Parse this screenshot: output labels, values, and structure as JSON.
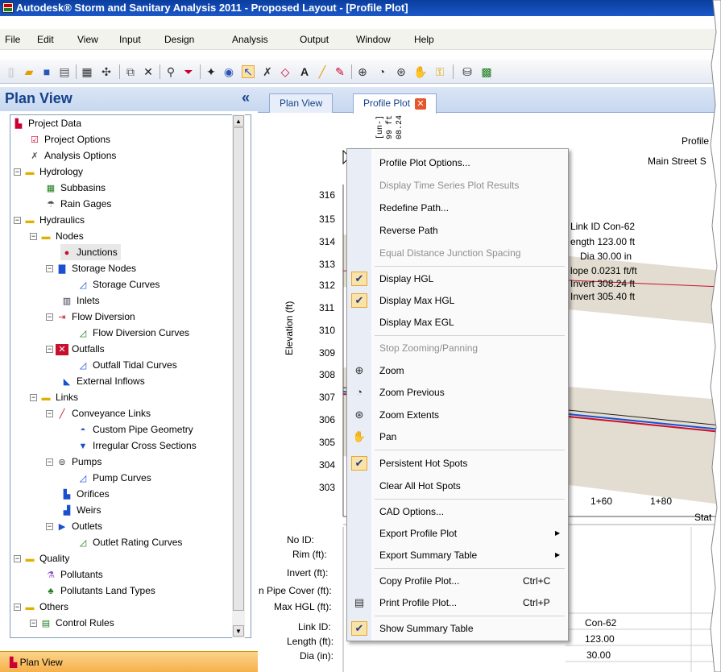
{
  "window": {
    "title": "Autodesk® Storm and Sanitary Analysis 2011 - Proposed Layout - [Profile Plot]"
  },
  "menu": [
    "File",
    "Edit",
    "View",
    "Input",
    "Design",
    "Analysis",
    "Output",
    "Window",
    "Help"
  ],
  "toolbar_icons": [
    "new-icon",
    "open-icon",
    "save-icon",
    "print-icon",
    "calculator-icon",
    "crosshair-icon",
    "copy-icon",
    "delete-icon",
    "find-icon",
    "filter-icon",
    "run-icon",
    "help-icon",
    "select-icon",
    "tools-icon",
    "polygon-icon",
    "text-icon",
    "measure-icon",
    "edit-icon",
    "zoom-in-icon",
    "zoom-previous-icon",
    "zoom-extents-icon",
    "pan-icon",
    "lock-icon",
    "network-icon",
    "spreadsheet-icon"
  ],
  "left_panel": {
    "title": "Plan View",
    "collapse": "«",
    "tree": [
      {
        "label": "Project Data",
        "icon": "project-data-icon"
      },
      {
        "label": "Project Options",
        "icon": "checklist-icon"
      },
      {
        "label": "Analysis Options",
        "icon": "tools-icon"
      },
      {
        "label": "Hydrology",
        "icon": "folder-icon"
      },
      {
        "label": "Subbasins",
        "icon": "subbasin-icon"
      },
      {
        "label": "Rain Gages",
        "icon": "rain-gage-icon"
      },
      {
        "label": "Hydraulics",
        "icon": "folder-icon"
      },
      {
        "label": "Nodes",
        "icon": "folder-icon"
      },
      {
        "label": "Junctions",
        "icon": "junction-icon"
      },
      {
        "label": "Storage Nodes",
        "icon": "storage-icon"
      },
      {
        "label": "Storage Curves",
        "icon": "curve-icon"
      },
      {
        "label": "Inlets",
        "icon": "inlet-icon"
      },
      {
        "label": "Flow Diversion",
        "icon": "flow-diversion-icon"
      },
      {
        "label": "Flow Diversion Curves",
        "icon": "curve-icon"
      },
      {
        "label": "Outfalls",
        "icon": "outfall-icon"
      },
      {
        "label": "Outfall Tidal Curves",
        "icon": "curve-icon"
      },
      {
        "label": "External Inflows",
        "icon": "inflow-icon"
      },
      {
        "label": "Links",
        "icon": "folder-icon"
      },
      {
        "label": "Conveyance Links",
        "icon": "conveyance-icon"
      },
      {
        "label": "Custom Pipe Geometry",
        "icon": "pipe-geometry-icon"
      },
      {
        "label": "Irregular Cross Sections",
        "icon": "cross-section-icon"
      },
      {
        "label": "Pumps",
        "icon": "pump-icon"
      },
      {
        "label": "Pump Curves",
        "icon": "curve-icon"
      },
      {
        "label": "Orifices",
        "icon": "orifice-icon"
      },
      {
        "label": "Weirs",
        "icon": "weir-icon"
      },
      {
        "label": "Outlets",
        "icon": "outlet-icon"
      },
      {
        "label": "Outlet Rating Curves",
        "icon": "curve-icon"
      },
      {
        "label": "Quality",
        "icon": "folder-icon"
      },
      {
        "label": "Pollutants",
        "icon": "flask-icon"
      },
      {
        "label": "Pollutants Land Types",
        "icon": "tree-icon"
      },
      {
        "label": "Others",
        "icon": "folder-icon"
      },
      {
        "label": "Control Rules",
        "icon": "control-rules-icon"
      }
    ],
    "bottom_tab": "Plan View"
  },
  "tabs": [
    "Plan View",
    "Profile Plot"
  ],
  "plot": {
    "title_fragment": "Profile P",
    "subtitle_fragment": "Main Street S",
    "rotated_labels": [
      "[un-]",
      "99 ft",
      "08.24"
    ],
    "y_axis_label": "Elevation (ft)",
    "y_ticks": [
      "316",
      "315",
      "314",
      "313",
      "312",
      "311",
      "310",
      "309",
      "308",
      "307",
      "306",
      "305",
      "304",
      "303"
    ],
    "x_ticks": [
      "1+60",
      "1+80"
    ],
    "x_axis_fragment": "Stat",
    "link_annotation": [
      "Link ID Con-62",
      "ength 123.00 ft",
      "Dia 30.00 in",
      "lope 0.0231 ft/ft",
      "Invert 308.24 ft",
      "Invert 305.40 ft"
    ],
    "summary_labels": [
      "No  ID:",
      "Rim (ft):",
      "Invert (ft):",
      "n Pipe Cover (ft):",
      "Max HGL (ft):",
      "Link ID:",
      "Length (ft):",
      "Dia (in):"
    ],
    "summary_values": [
      "Con-62",
      "123.00",
      "30.00"
    ]
  },
  "context_menu": [
    {
      "label": "Profile Plot Options...",
      "enabled": true
    },
    {
      "label": "Display Time Series Plot Results",
      "enabled": false
    },
    {
      "label": "Redefine Path...",
      "enabled": true
    },
    {
      "label": "Reverse Path",
      "enabled": true
    },
    {
      "label": "Equal Distance Junction Spacing",
      "enabled": false
    },
    {
      "label": "Display HGL",
      "enabled": true,
      "checked": true
    },
    {
      "label": "Display Max HGL",
      "enabled": true,
      "checked": true
    },
    {
      "label": "Display Max EGL",
      "enabled": true
    },
    {
      "label": "Stop Zooming/Panning",
      "enabled": false
    },
    {
      "label": "Zoom",
      "enabled": true,
      "icon": "zoom-icon"
    },
    {
      "label": "Zoom Previous",
      "enabled": true,
      "icon": "zoom-previous-icon"
    },
    {
      "label": "Zoom Extents",
      "enabled": true,
      "icon": "zoom-extents-icon"
    },
    {
      "label": "Pan",
      "enabled": true,
      "icon": "pan-hand-icon"
    },
    {
      "label": "Persistent Hot Spots",
      "enabled": true,
      "checked": true
    },
    {
      "label": "Clear All Hot Spots",
      "enabled": true
    },
    {
      "label": "CAD Options...",
      "enabled": true
    },
    {
      "label": "Export Profile Plot",
      "enabled": true,
      "submenu": true
    },
    {
      "label": "Export Summary Table",
      "enabled": true,
      "submenu": true
    },
    {
      "label": "Copy Profile Plot...",
      "enabled": true,
      "shortcut": "Ctrl+C"
    },
    {
      "label": "Print Profile Plot...",
      "enabled": true,
      "shortcut": "Ctrl+P",
      "icon": "printer-icon"
    },
    {
      "label": "Show Summary Table",
      "enabled": true,
      "checked": true
    }
  ],
  "colors": {
    "title_bar": "#0a3d9e",
    "panel_header": "#c6d7ef",
    "bottom_tab": "#f6b04b",
    "ground": "#e2ddd0",
    "hgl_blue": "#1a4fd0",
    "hgl_red": "#c8102e"
  }
}
